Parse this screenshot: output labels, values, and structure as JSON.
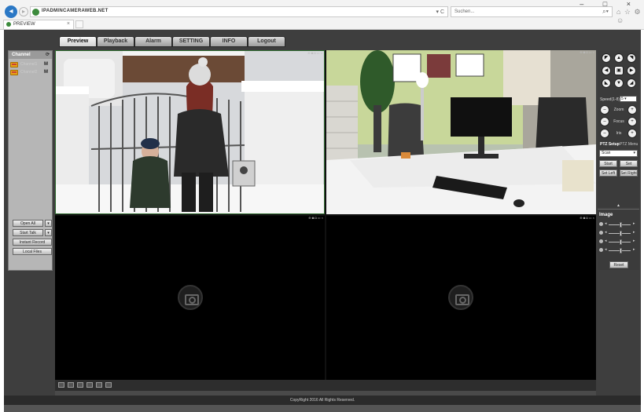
{
  "browser": {
    "url": "IPADMINCAMERAWEB.NET",
    "address_controls": "▾ C",
    "search_placeholder": "Suchen...",
    "tab_label": "PREVIEW",
    "tab_close": "×",
    "window_controls": "– □ ×",
    "toolbar_icons": "⌂ ☆ ⚙ ☺"
  },
  "nav": {
    "tabs": [
      {
        "label": "Preview",
        "active": true
      },
      {
        "label": "Playback"
      },
      {
        "label": "Alarm"
      },
      {
        "label": "SETTING"
      },
      {
        "label": "INFO"
      },
      {
        "label": "Logout"
      }
    ]
  },
  "left_panel": {
    "header": "Channel",
    "refresh": "⟳",
    "channels": [
      {
        "name": "Channel1",
        "badge": "M"
      },
      {
        "name": "Channel2",
        "badge": "M"
      }
    ],
    "buttons": {
      "open_all": "Open All",
      "start_talk": "Start Talk",
      "instant_record": "Instant Record",
      "local_files": "Local Files",
      "arrow": "▾"
    }
  },
  "video": {
    "cell_toolbar": "⊕ ◙ ◘ ▭ ×",
    "scenes": [
      "children-at-gate",
      "office-desk"
    ],
    "empty_slots": 2
  },
  "ptz": {
    "speed_label": "Speed(1-8)",
    "speed_value": "5",
    "zoom_label": "Zoom",
    "focus_label": "Focus",
    "iris_label": "Iris",
    "setup_tab": "PTZ Setup",
    "menu_tab": "PTZ Menu",
    "mode_value": "Scan",
    "start": "Start",
    "set": "Set",
    "set_left": "Set Left",
    "set_right": "Set Right",
    "minus": "–",
    "plus": "+",
    "collapse": "▲"
  },
  "image": {
    "tab": "Image",
    "left_arrow": "◂",
    "right_arrow": "▸",
    "sliders": [
      {
        "name": "brightness",
        "value": 0.55
      },
      {
        "name": "contrast",
        "value": 0.55
      },
      {
        "name": "saturation",
        "value": 0.55
      },
      {
        "name": "hue",
        "value": 0.55
      }
    ],
    "reset": "Reset"
  },
  "footer": {
    "copyright": "CopyRight 2016 All Rights Reserved."
  },
  "colors": {
    "app_bg": "#3e3e3e",
    "accent_orange": "#e8a317",
    "active_border": "#2f6b2f"
  }
}
